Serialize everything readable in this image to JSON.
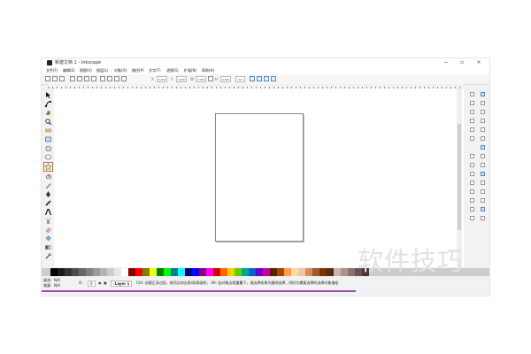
{
  "window": {
    "title": "新建文档 1 - Inkscape",
    "controls": [
      "−",
      "▫",
      "×"
    ]
  },
  "menu": [
    "文件(F)",
    "编辑(E)",
    "视图(V)",
    "图层(L)",
    "对象(O)",
    "路径(P)",
    "文字(T)",
    "滤镜(S)",
    "扩展(N)",
    "帮助(H)"
  ],
  "commandbar": {
    "x_label": "X",
    "x_value": "0.000",
    "y_label": "Y",
    "y_value": "0.000",
    "w_label": "W",
    "w_value": "0.000",
    "h_label": "H",
    "h_value": "0.000",
    "unit": "mm"
  },
  "toolbox": {
    "tools": [
      "selector-tool",
      "node-tool",
      "tweak-tool",
      "zoom-tool",
      "measure-tool",
      "rectangle-tool",
      "3d-box-tool",
      "ellipse-tool",
      "star-tool",
      "spiral-tool",
      "pencil-tool",
      "pen-tool",
      "calligraphy-tool",
      "text-tool",
      "spray-tool",
      "eraser-tool",
      "bucket-tool",
      "gradient-tool",
      "dropper-tool"
    ],
    "selected": "star-tool"
  },
  "status": {
    "fill_label": "填充:",
    "fill_value": "N/A",
    "stroke_label": "笔廓:",
    "stroke_value": "N/A",
    "opacity_label": "O:",
    "opacity_value": "0",
    "layer_value": "-Layer 1",
    "hint": "Ctrl: 创建正多边形，按顶点的尖角/距离吸附； Alt: 若对象边框重叠下，请选择如果为删除选择，同时为需要选择的选择对象描绘"
  },
  "palette_colors": [
    "#000000",
    "#1a1a1a",
    "#333333",
    "#4d4d4d",
    "#666666",
    "#808080",
    "#999999",
    "#b3b3b3",
    "#cccccc",
    "#e6e6e6",
    "#ffffff",
    "#800000",
    "#ff0000",
    "#808000",
    "#ffff00",
    "#008000",
    "#00ff00",
    "#008080",
    "#00ffff",
    "#000080",
    "#0000ff",
    "#800080",
    "#ff00ff",
    "#d40000",
    "#ff6600",
    "#ffcc00",
    "#66cc00",
    "#00aa88",
    "#0066cc",
    "#6600cc",
    "#cc0099",
    "#552200",
    "#aa4400",
    "#ff9955",
    "#ffdd99",
    "#e9c6af",
    "#d38d5f",
    "#a05a2c",
    "#803300",
    "#502d16",
    "#c8b7b7",
    "#ac9393",
    "#916f6f",
    "#6c5353",
    "#483737"
  ],
  "watermark": "软件技巧"
}
